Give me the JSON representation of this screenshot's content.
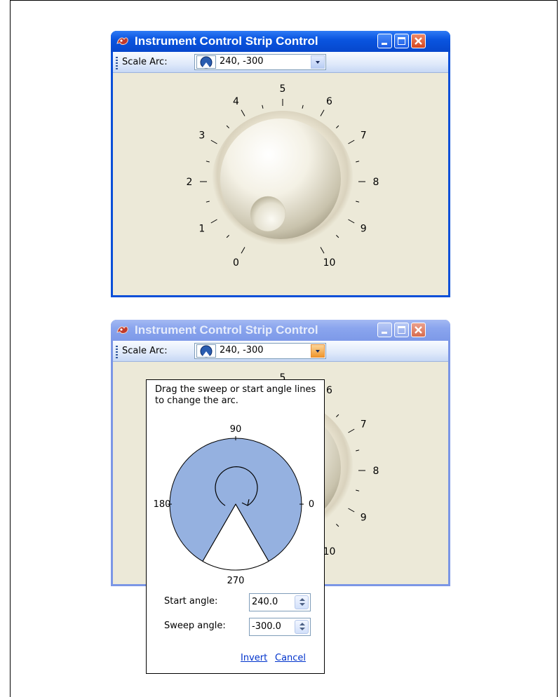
{
  "window_top": {
    "title": "Instrument Control Strip Control",
    "toolbar": {
      "label": "Scale Arc:",
      "combo_value": "240, -300"
    }
  },
  "window_bottom": {
    "title": "Instrument Control Strip Control",
    "toolbar": {
      "label": "Scale Arc:",
      "combo_value": "240, -300"
    }
  },
  "knob": {
    "scale_labels": [
      "0",
      "1",
      "2",
      "3",
      "4",
      "5",
      "6",
      "7",
      "8",
      "9",
      "10"
    ],
    "visible_labels_behind_popup": [
      "6",
      "7",
      "8",
      "9",
      "0"
    ]
  },
  "popup": {
    "hint": "Drag the sweep or start angle lines to change the arc.",
    "angle_labels": {
      "top": "90",
      "left": "180",
      "right": "0",
      "bottom": "270"
    },
    "start_angle": {
      "label": "Start angle:",
      "value": "240.0"
    },
    "sweep_angle": {
      "label": "Sweep angle:",
      "value": "-300.0"
    },
    "invert": "Invert",
    "cancel": "Cancel"
  },
  "colors": {
    "title_active": "#0a55e0",
    "title_inactive": "#8aa5ee",
    "client": "#ece9d8",
    "arc_fill": "#95b1e0",
    "combo_arrow_hot": "#f0962b"
  }
}
